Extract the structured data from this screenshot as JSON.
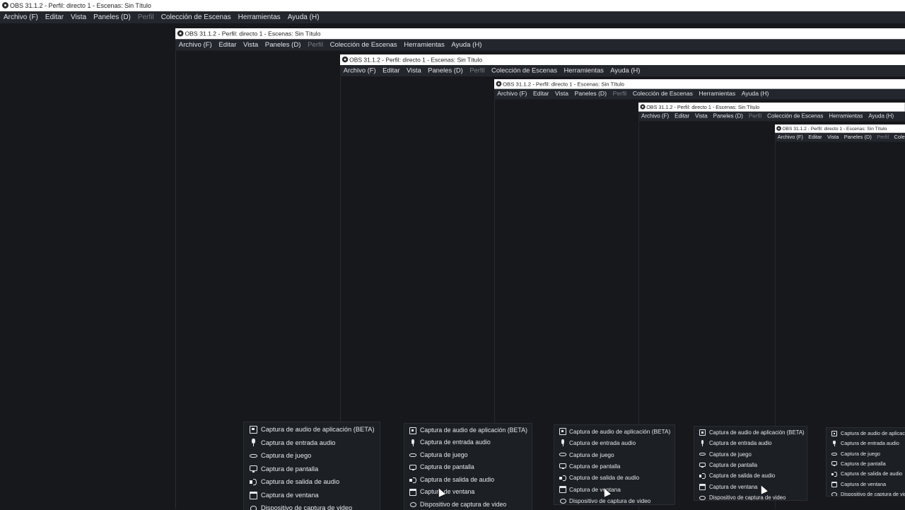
{
  "window": {
    "title": "OBS 31.1.2 - Perfil: directo 1 - Escenas: Sin Título",
    "menu": [
      {
        "label": "Archivo (F)",
        "disabled": false
      },
      {
        "label": "Editar",
        "disabled": false
      },
      {
        "label": "Vista",
        "disabled": false
      },
      {
        "label": "Paneles (D)",
        "disabled": false
      },
      {
        "label": "Perfil",
        "disabled": true
      },
      {
        "label": "Colección de Escenas",
        "disabled": false
      },
      {
        "label": "Herramientas",
        "disabled": false
      },
      {
        "label": "Ayuda (H)",
        "disabled": false
      }
    ]
  },
  "source_menu": {
    "items": [
      {
        "label": "Captura de audio de aplicación (BETA)",
        "icon": "app-audio-icon"
      },
      {
        "label": "Captura de entrada audio",
        "icon": "microphone-icon"
      },
      {
        "label": "Captura de juego",
        "icon": "gamepad-icon"
      },
      {
        "label": "Captura de pantalla",
        "icon": "monitor-icon"
      },
      {
        "label": "Captura de salida de audio",
        "icon": "speaker-icon"
      },
      {
        "label": "Captura de ventana",
        "icon": "window-icon"
      },
      {
        "label": "Dispositivo de captura de video",
        "icon": "camera-icon"
      }
    ]
  },
  "colors": {
    "background": "#16181c",
    "menubar": "#23262c",
    "titlebar": "#ffffff",
    "menu_text": "#e2e4e8",
    "disabled_text": "#7b7f86"
  }
}
